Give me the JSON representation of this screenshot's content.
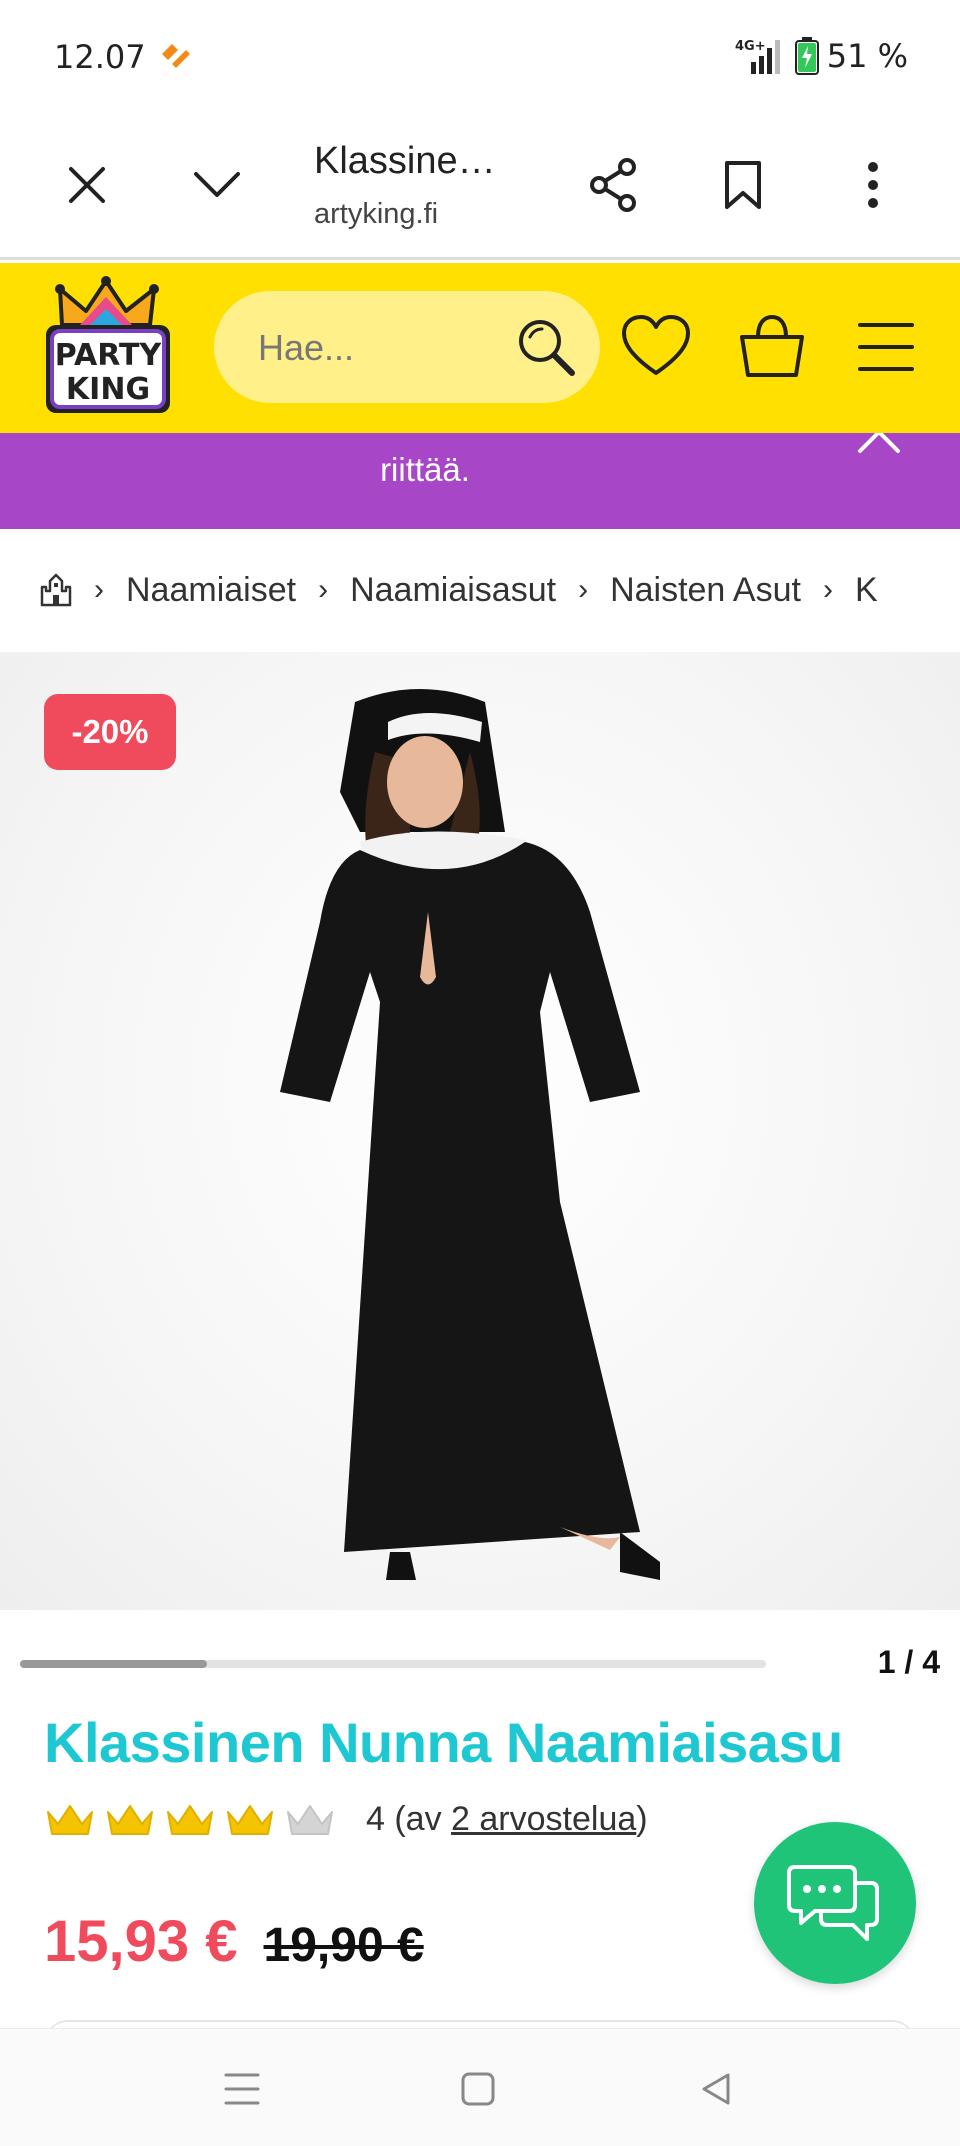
{
  "status_bar": {
    "time": "12.07",
    "network": "4G+",
    "battery": "51 %"
  },
  "browser": {
    "page_title": "Klassine…",
    "url": "artyking.fi",
    "close_icon": "close-icon",
    "tabs_icon": "chevron-down-icon",
    "share_icon": "share-icon",
    "bookmark_icon": "bookmark-icon",
    "menu_icon": "more-vert-icon"
  },
  "header": {
    "search_placeholder": "Hae...",
    "logo_text": "PARTY KING",
    "colors": {
      "background": "#ffe000",
      "search_bg": "#fff08a"
    }
  },
  "promo_banner": {
    "text": "riittää.",
    "color": "#a747c8"
  },
  "breadcrumb": {
    "items": [
      "Naamiaiset",
      "Naamiaisasut",
      "Naisten Asut",
      "K"
    ]
  },
  "product": {
    "discount_badge": "-20%",
    "gallery_counter": "1 / 4",
    "gallery_progress": 0.25,
    "title": "Klassinen Nunna Naamiaisasu",
    "rating": {
      "score": 4,
      "max": 5,
      "text_prefix": "4 (av ",
      "reviews_link": "2 arvostelua",
      "text_suffix": ")"
    },
    "price_current": "15,93 €",
    "price_old": "19,90 €",
    "colors": {
      "title": "#1dc8d3",
      "price": "#f04b5d",
      "badge": "#f04b5d",
      "chat": "#1fc479"
    }
  }
}
